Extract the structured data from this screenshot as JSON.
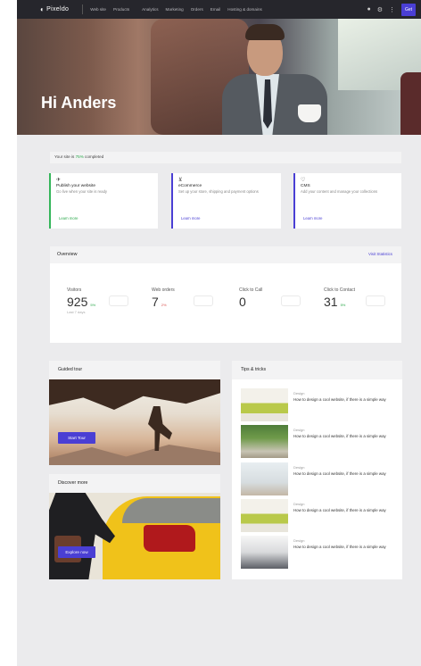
{
  "app": {
    "logo_text": "Pixeldo",
    "nav_left": [
      "Web site",
      "Products"
    ],
    "nav_right": [
      "Analytics",
      "Marketing",
      "Orders",
      "Email",
      "Hosting & domains"
    ],
    "upgrade_label": "Get"
  },
  "hero": {
    "greeting": "Hi Anders"
  },
  "progress": {
    "prefix": "Your site is ",
    "highlight": "75%",
    "suffix": " completed"
  },
  "tasks": [
    {
      "title": "Publish your website",
      "desc": "Go live when your site is ready",
      "link": "Learn more",
      "icon": "rocket-icon"
    },
    {
      "title": "eCommerce",
      "desc": "Set up your store, shipping and payment options",
      "link": "Learn more",
      "icon": "cart-icon"
    },
    {
      "title": "CMS",
      "desc": "Add your content and manage your collections",
      "link": "Learn more",
      "icon": "heart-icon"
    }
  ],
  "overview": {
    "title": "Overview",
    "link": "Visit Statistics",
    "stats": [
      {
        "label": "Visitors",
        "value": "925",
        "change": "5%",
        "sub": "Last 7 days"
      },
      {
        "label": "Web orders",
        "value": "7",
        "change": "2%",
        "sub": ""
      },
      {
        "label": "Click to Call",
        "value": "0",
        "change": "",
        "sub": ""
      },
      {
        "label": "Click to Contact",
        "value": "31",
        "change": "5%",
        "sub": ""
      }
    ]
  },
  "guided_tour": {
    "title": "Guided tour",
    "button": "Start Tour"
  },
  "discover": {
    "title": "Discover more",
    "button": "Explore now"
  },
  "tips": {
    "title": "Tips & tricks",
    "items": [
      {
        "category": "Design",
        "text": "How to design a cool website, if there is a simple way"
      },
      {
        "category": "Design",
        "text": "How to design a cool website, if there is a simple way"
      },
      {
        "category": "Design",
        "text": "How to design a cool website, if there is a simple way"
      },
      {
        "category": "Design",
        "text": "How to design a cool website, if there is a simple way"
      },
      {
        "category": "Design",
        "text": "How to design a cool website, if there is a simple way"
      }
    ]
  },
  "colors": {
    "accent": "#4a3fd4",
    "success": "#2aa84a",
    "topbar": "#26262c"
  }
}
